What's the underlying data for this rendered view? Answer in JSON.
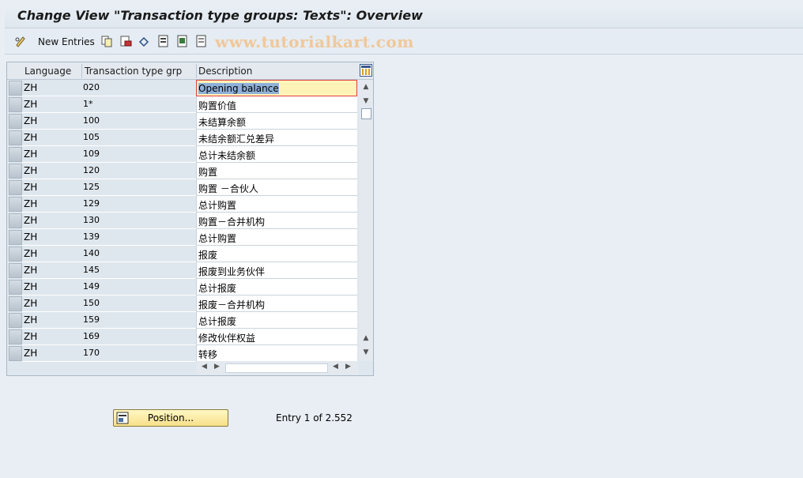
{
  "window": {
    "title": "Change View \"Transaction type groups: Texts\": Overview"
  },
  "toolbar": {
    "new_entries_label": "New Entries",
    "watermark": "www.tutorialkart.com"
  },
  "table": {
    "columns": [
      "Language",
      "Transaction type grp",
      "Description"
    ],
    "rows": [
      {
        "language": "ZH",
        "code": "020",
        "description": "Opening balance"
      },
      {
        "language": "ZH",
        "code": "1*",
        "description": "购置价值"
      },
      {
        "language": "ZH",
        "code": "100",
        "description": "未结算余额"
      },
      {
        "language": "ZH",
        "code": "105",
        "description": "未结余额汇兑差异"
      },
      {
        "language": "ZH",
        "code": "109",
        "description": "总计未结余额"
      },
      {
        "language": "ZH",
        "code": "120",
        "description": "购置"
      },
      {
        "language": "ZH",
        "code": "125",
        "description": "购置 －合伙人"
      },
      {
        "language": "ZH",
        "code": "129",
        "description": "总计购置"
      },
      {
        "language": "ZH",
        "code": "130",
        "description": "购置－合并机构"
      },
      {
        "language": "ZH",
        "code": "139",
        "description": "总计购置"
      },
      {
        "language": "ZH",
        "code": "140",
        "description": "报废"
      },
      {
        "language": "ZH",
        "code": "145",
        "description": "报废到业务伙伴"
      },
      {
        "language": "ZH",
        "code": "149",
        "description": "总计报废"
      },
      {
        "language": "ZH",
        "code": "150",
        "description": "报废－合并机构"
      },
      {
        "language": "ZH",
        "code": "159",
        "description": "总计报废"
      },
      {
        "language": "ZH",
        "code": "169",
        "description": "修改伙伴权益"
      },
      {
        "language": "ZH",
        "code": "170",
        "description": "转移"
      }
    ]
  },
  "footer": {
    "position_label": "Position...",
    "entry_text": "Entry 1 of 2.552"
  },
  "icons": {
    "toolbar": [
      "pencil-glasses-icon",
      "copy-icon",
      "delete-icon",
      "undo-icon",
      "select-all-icon",
      "select-block-icon",
      "deselect-all-icon"
    ],
    "position": "position-icon",
    "column_settings": "table-settings-icon"
  }
}
